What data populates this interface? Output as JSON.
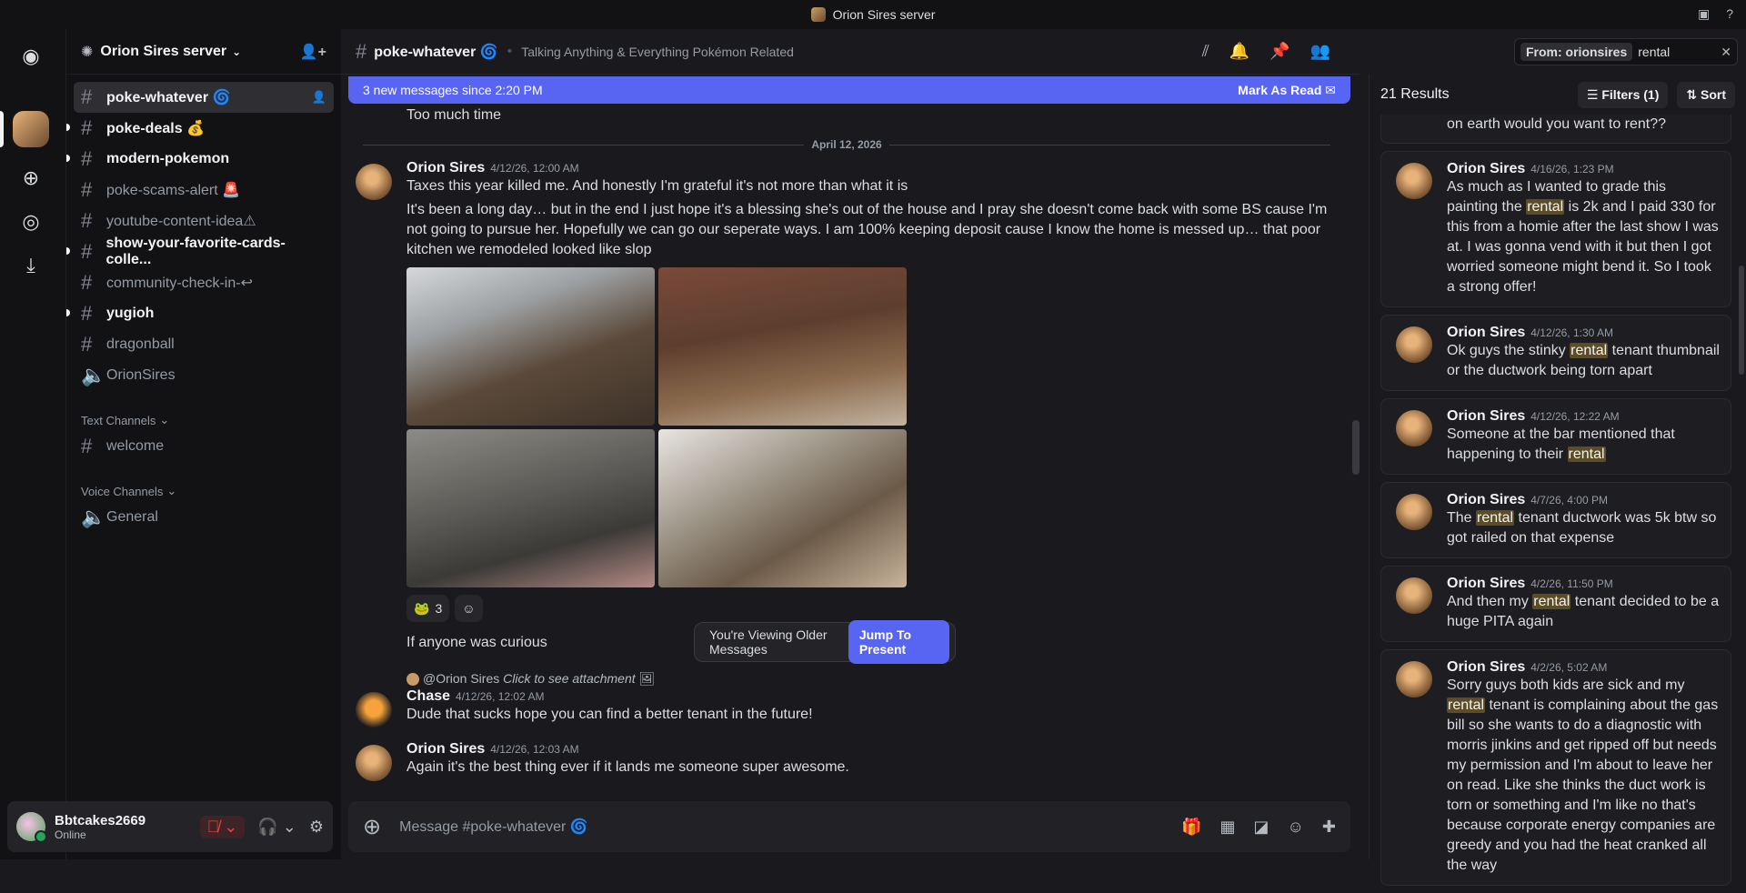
{
  "window": {
    "title": "Orion Sires server"
  },
  "server": {
    "name": "Orion Sires server"
  },
  "channels": [
    {
      "name": "poke-whatever 🌀",
      "state": "active"
    },
    {
      "name": "poke-deals 💰",
      "state": "unread"
    },
    {
      "name": "modern-pokemon",
      "state": "unread"
    },
    {
      "name": "poke-scams-alert 🚨",
      "state": "normal"
    },
    {
      "name": "youtube-content-idea⚠",
      "state": "normal"
    },
    {
      "name": "show-your-favorite-cards-colle...",
      "state": "unread"
    },
    {
      "name": "community-check-in-↩",
      "state": "normal"
    },
    {
      "name": "yugioh",
      "state": "unread"
    },
    {
      "name": "dragonball",
      "state": "normal"
    },
    {
      "name": "OrionSires",
      "state": "voice"
    }
  ],
  "categories": {
    "text": {
      "label": "Text Channels",
      "channel": "welcome"
    },
    "voice": {
      "label": "Voice Channels",
      "channel": "General"
    }
  },
  "user": {
    "name": "Bbtcakes2669",
    "status": "Online"
  },
  "header": {
    "channel": "poke-whatever 🌀",
    "topic": "Talking Anything & Everything Pokémon Related"
  },
  "new_bar": {
    "text": "3 new messages since 2:20 PM",
    "mark": "Mark As Read"
  },
  "messages": {
    "top_text": "Too much time",
    "date_sep": "April 12, 2026",
    "m1": {
      "author": "Orion Sires",
      "time": "4/12/26, 12:00 AM",
      "line1": "Taxes this year killed me. And honestly I'm grateful it's not more than what it is",
      "line2": "It's been a long day… but in the end I just hope it's a blessing she's out of the house and I pray she doesn't come back with some BS cause I'm not going to pursue her. Hopefully we can go our seperate ways. I am 100% keeping deposit cause I know the home is messed up… that poor kitchen we remodeled looked like slop",
      "reaction_count": "3",
      "after": "If anyone was curious"
    },
    "m2": {
      "reply_to": "@Orion Sires",
      "reply_note": "Click to see attachment",
      "author": "Chase",
      "time": "4/12/26, 12:02 AM",
      "text": "Dude that sucks hope you can find a better tenant in the future!"
    },
    "m3": {
      "author": "Orion Sires",
      "time": "4/12/26, 12:03 AM",
      "text": "Again it's the best thing ever if it lands me someone super awesome."
    }
  },
  "older_pill": {
    "text": "You're Viewing Older Messages",
    "button": "Jump To Present"
  },
  "composer": {
    "placeholder": "Message #poke-whatever 🌀"
  },
  "search": {
    "chip": "From: orionsires",
    "query": "rental"
  },
  "results": {
    "count": "21 Results",
    "filters": "Filters (1)",
    "sort": "Sort",
    "partial_top": "on earth would you want to rent??",
    "items": [
      {
        "author": "Orion Sires",
        "time": "4/16/26, 1:23 PM",
        "pre": "As much as I wanted to grade this painting the ",
        "hl": "rental",
        "post": " is 2k and I paid 330 for this from a homie after the last show I was at. I was gonna vend with it but then I got worried someone might bend it. So I took a strong offer!"
      },
      {
        "author": "Orion Sires",
        "time": "4/12/26, 1:30 AM",
        "pre": "Ok guys the stinky ",
        "hl": "rental",
        "post": " tenant thumbnail or the ductwork being torn apart"
      },
      {
        "author": "Orion Sires",
        "time": "4/12/26, 12:22 AM",
        "pre": "Someone at the bar mentioned that happening to their ",
        "hl": "rental",
        "post": ""
      },
      {
        "author": "Orion Sires",
        "time": "4/7/26, 4:00 PM",
        "pre": "The ",
        "hl": "rental",
        "post": " tenant ductwork was 5k btw so got railed on that expense"
      },
      {
        "author": "Orion Sires",
        "time": "4/2/26, 11:50 PM",
        "pre": "And then my ",
        "hl": "rental",
        "post": " tenant decided to be a huge PITA again"
      },
      {
        "author": "Orion Sires",
        "time": "4/2/26, 5:02 AM",
        "pre": "Sorry guys both kids are sick and my ",
        "hl": "rental",
        "post": " tenant is complaining about the gas bill so she wants to do a diagnostic with morris jinkins and get ripped off but needs my permission and I'm about to leave her on read. Like she thinks the duct work is torn or something and I'm like no that's because corporate energy companies are greedy and you had the heat cranked all the way"
      }
    ]
  }
}
